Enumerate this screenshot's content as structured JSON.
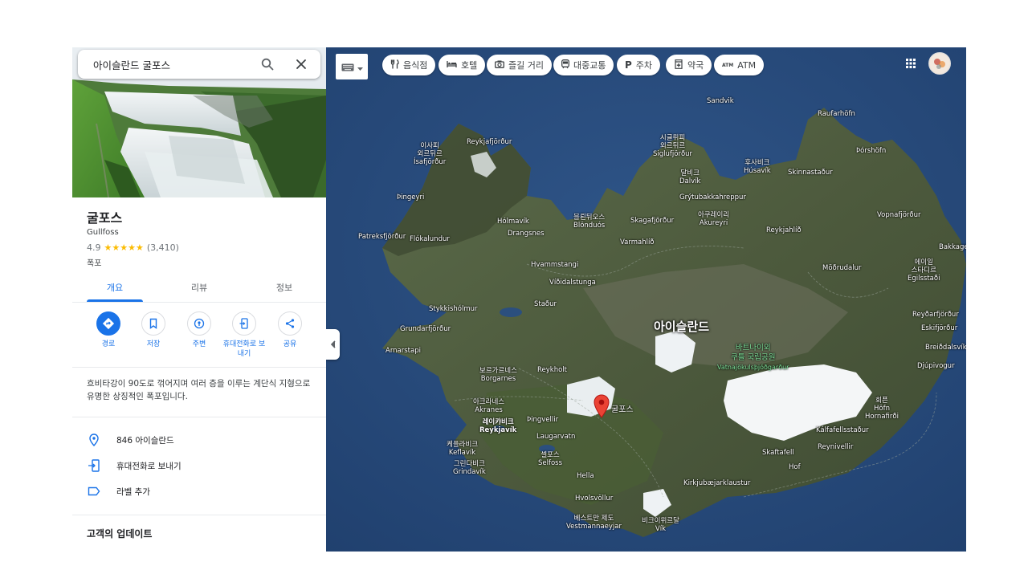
{
  "search": {
    "value": "아이슬란드 굴포스"
  },
  "place": {
    "name": "굴포스",
    "name_en": "Gullfoss",
    "rating": "4.9",
    "stars": "★★★★★",
    "reviews": "(3,410)",
    "category": "폭포",
    "description": "흐비타강이 90도로 꺾어지며 여러 층을 이루는 계단식 지형으로 유명한 상징적인 폭포입니다."
  },
  "tabs": [
    {
      "label": "개요",
      "active": true
    },
    {
      "label": "리뷰",
      "active": false
    },
    {
      "label": "정보",
      "active": false
    }
  ],
  "actions": [
    {
      "label": "경로",
      "icon": "directions-icon"
    },
    {
      "label": "저장",
      "icon": "bookmark-icon"
    },
    {
      "label": "주변",
      "icon": "nearby-icon"
    },
    {
      "label": "휴대전화로 보내기",
      "icon": "send-to-phone-icon"
    },
    {
      "label": "공유",
      "icon": "share-icon"
    }
  ],
  "info": [
    {
      "text": "846 아이슬란드",
      "icon": "location-pin-icon"
    },
    {
      "text": "휴대전화로 보내기",
      "icon": "send-to-phone-icon"
    },
    {
      "text": "라벨 추가",
      "icon": "label-icon"
    }
  ],
  "updates_heading": "고객의 업데이트",
  "map_chips": [
    {
      "label": "음식점",
      "icon": "restaurant-icon"
    },
    {
      "label": "호텔",
      "icon": "hotel-icon"
    },
    {
      "label": "즐길 거리",
      "icon": "camera-icon"
    },
    {
      "label": "대중교통",
      "icon": "transit-icon"
    },
    {
      "label": "주차",
      "icon": "parking-icon"
    },
    {
      "label": "약국",
      "icon": "pharmacy-icon"
    },
    {
      "label": "ATM",
      "icon": "atm-icon"
    }
  ],
  "map": {
    "country_label": "아이슬란드",
    "park_label_ko": "바트나이외\n쿠틀 국립공원",
    "park_label_en": "Vatnajökulsþjóðgarður",
    "pin_label": "굴포스",
    "places": [
      {
        "text": "Sandvik"
      },
      {
        "text": "Raufarhöfn"
      },
      {
        "text": "Reykjafjörður"
      },
      {
        "text": "이사피\n외르뒤르\nÍsafjörður"
      },
      {
        "text": "시글뤼피\n외르뒤르\nSiglufjörður"
      },
      {
        "text": "Þórshöfn"
      },
      {
        "text": "후사비크\nHúsavík"
      },
      {
        "text": "Skinnastaður"
      },
      {
        "text": "달비크\nDalvík"
      },
      {
        "text": "Grýtubakkahreppur"
      },
      {
        "text": "Þingeyri"
      },
      {
        "text": "블뢴뒤오스\nBlönduós"
      },
      {
        "text": "Skagafjörður"
      },
      {
        "text": "아쿠레이리\nAkureyri"
      },
      {
        "text": "Vopnafjörður"
      },
      {
        "text": "Hólmavík"
      },
      {
        "text": "Drangsnes"
      },
      {
        "text": "Varmahlíð"
      },
      {
        "text": "Reykjahlíð"
      },
      {
        "text": "Patreksfjörður"
      },
      {
        "text": "Flókalundur"
      },
      {
        "text": "Bakkage"
      },
      {
        "text": "Hvammstangi"
      },
      {
        "text": "Víðidalstunga"
      },
      {
        "text": "Möðrudalur"
      },
      {
        "text": "에이일\n스타디르\nEgilsstaði"
      },
      {
        "text": "Stykkishólmur"
      },
      {
        "text": "Staður"
      },
      {
        "text": "Reyðarfjörður"
      },
      {
        "text": "Grundarfjörður"
      },
      {
        "text": "Eskifjörður"
      },
      {
        "text": "Arnarstapi"
      },
      {
        "text": "Breiðdalsvík"
      },
      {
        "text": "보르가르네스\nBorgarnes"
      },
      {
        "text": "Reykholt"
      },
      {
        "text": "Djúpivogur"
      },
      {
        "text": "아크라네스\nAkranes"
      },
      {
        "text": "레이캬비크\nReykjavík"
      },
      {
        "text": "Þingvellir"
      },
      {
        "text": "회픈\nHöfn\nHornafirði"
      },
      {
        "text": "Laugarvatn"
      },
      {
        "text": "Kálfafellsstaður"
      },
      {
        "text": "케플라비크\nKeflavík"
      },
      {
        "text": "Reynivellir"
      },
      {
        "text": "그린다비크\nGrindavík"
      },
      {
        "text": "셀포스\nSelfoss"
      },
      {
        "text": "Skaftafell"
      },
      {
        "text": "Hella"
      },
      {
        "text": "Kirkjubæjarklaustur"
      },
      {
        "text": "Hof"
      },
      {
        "text": "Hvolsvöllur"
      },
      {
        "text": "베스트만 제도\nVestmannaeyjar"
      },
      {
        "text": "비크이뮈르달\nVík"
      }
    ]
  },
  "colors": {
    "accent": "#1a73e8",
    "star": "#fbbc04",
    "pin": "#ea4335",
    "park": "#7ee29a"
  }
}
